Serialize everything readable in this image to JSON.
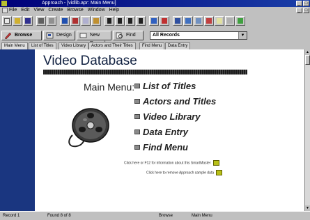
{
  "window": {
    "title": "Approach - [vidlib.apr: Main Menu]"
  },
  "menu": {
    "items": [
      "File",
      "Edit",
      "View",
      "Create",
      "Browse",
      "Window",
      "Help"
    ]
  },
  "nav": {
    "browse": "Browse",
    "design": "Design",
    "new_record": "New Record",
    "find": "Find",
    "records_select": "All Records"
  },
  "tabs": [
    "Main Menu",
    "List of Titles",
    "Video Library",
    "Actors and Their Titles",
    "Find Menu",
    "Data Entry"
  ],
  "content": {
    "title": "Video Database",
    "main_label": "Main Menu:",
    "menu_items": [
      "List of Titles",
      "Actors and Titles",
      "Video Library",
      "Data Entry",
      "Find Menu"
    ],
    "help_line1": "Click here or F12 for information about this SmartMaster",
    "help_line2": "Click here to remove Approach sample data"
  },
  "status": {
    "record": "Record 1",
    "found": "Found 8 of 8",
    "mode": "Browse",
    "view": "Main Menu"
  }
}
